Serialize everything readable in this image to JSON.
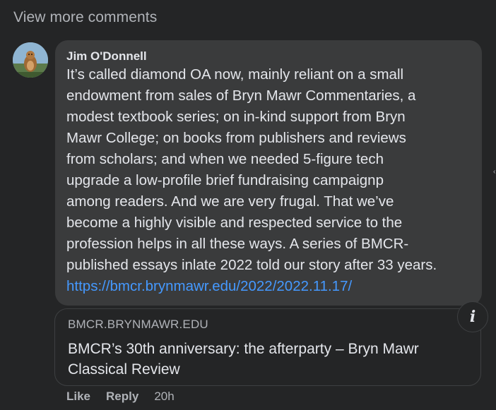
{
  "thread": {
    "view_more_label": "View more comments"
  },
  "comment": {
    "author": "Jim O'Donnell",
    "text": "It’s called diamond OA now, mainly reliant on a small\nendowment from sales of Bryn Mawr Commentaries, a\nmodest textbook series; on in-kind support from Bryn\nMawr College; on books from publishers and reviews\nfrom scholars; and when we needed 5-figure tech\nupgrade a low-profile brief fundraising campaignp\namong readers. And we are very frugal. That we’ve\nbecome a highly visible and respected service to the\nprofession helps in all these ways. A series of BMCR-\npublished essays inlate 2022 told our story after 33 years.",
    "link": "https://bmcr.brynmawr.edu/2022/2022.11.17/",
    "link_color": "#4599ff"
  },
  "link_preview": {
    "domain": "BMCR.BRYNMAWR.EDU",
    "title": "BMCR’s 30th anniversary: the afterparty – Bryn Mawr Classical Review",
    "info_icon": "info-icon"
  },
  "actions": {
    "like_label": "Like",
    "reply_label": "Reply",
    "timestamp": "20h"
  },
  "theme": {
    "background": "#242526",
    "bubble": "#3a3b3c",
    "text": "#e4e6eb",
    "secondary_text": "#b0b3b8"
  }
}
